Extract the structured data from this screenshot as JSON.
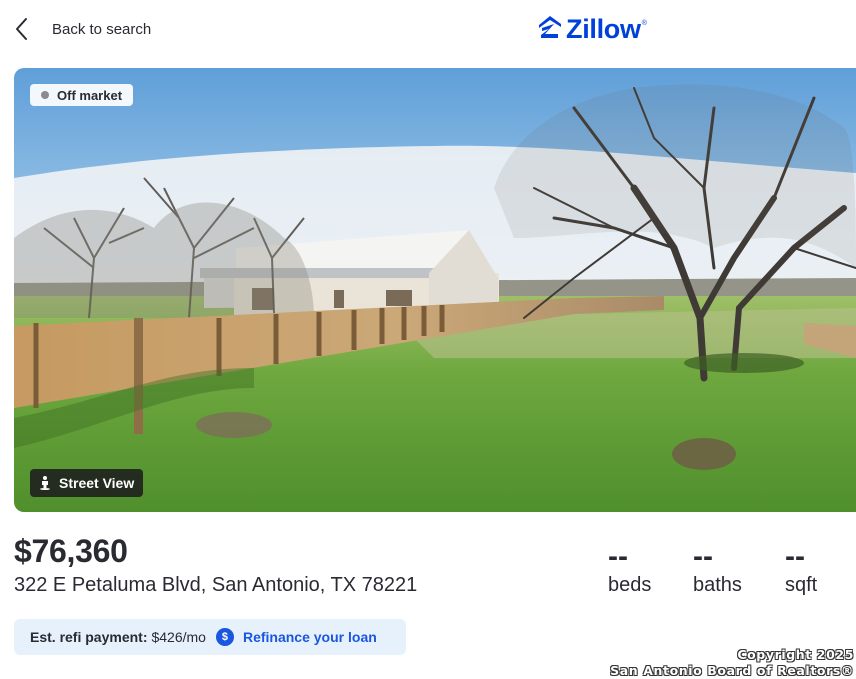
{
  "header": {
    "back_label": "Back to search",
    "logo_text": "Zillow",
    "logo_mark": "®"
  },
  "photo": {
    "badge": "Off market",
    "street_view_label": "Street View"
  },
  "listing": {
    "price": "$76,360",
    "address": "322 E Petaluma Blvd, San Antonio, TX 78221",
    "facts": [
      {
        "value": "--",
        "label": "beds"
      },
      {
        "value": "--",
        "label": "baths"
      },
      {
        "value": "--",
        "label": "sqft"
      }
    ]
  },
  "refi": {
    "label": "Est. refi payment:",
    "amount": "$426/mo",
    "coin": "$",
    "link": "Refinance your loan"
  },
  "copyright": {
    "line1": "Copyright 2025",
    "line2": "San Antonio Board of Realtors®"
  },
  "colors": {
    "brand": "#0041d9",
    "link": "#1a57e0",
    "refi_bg": "#e6f1fb"
  }
}
